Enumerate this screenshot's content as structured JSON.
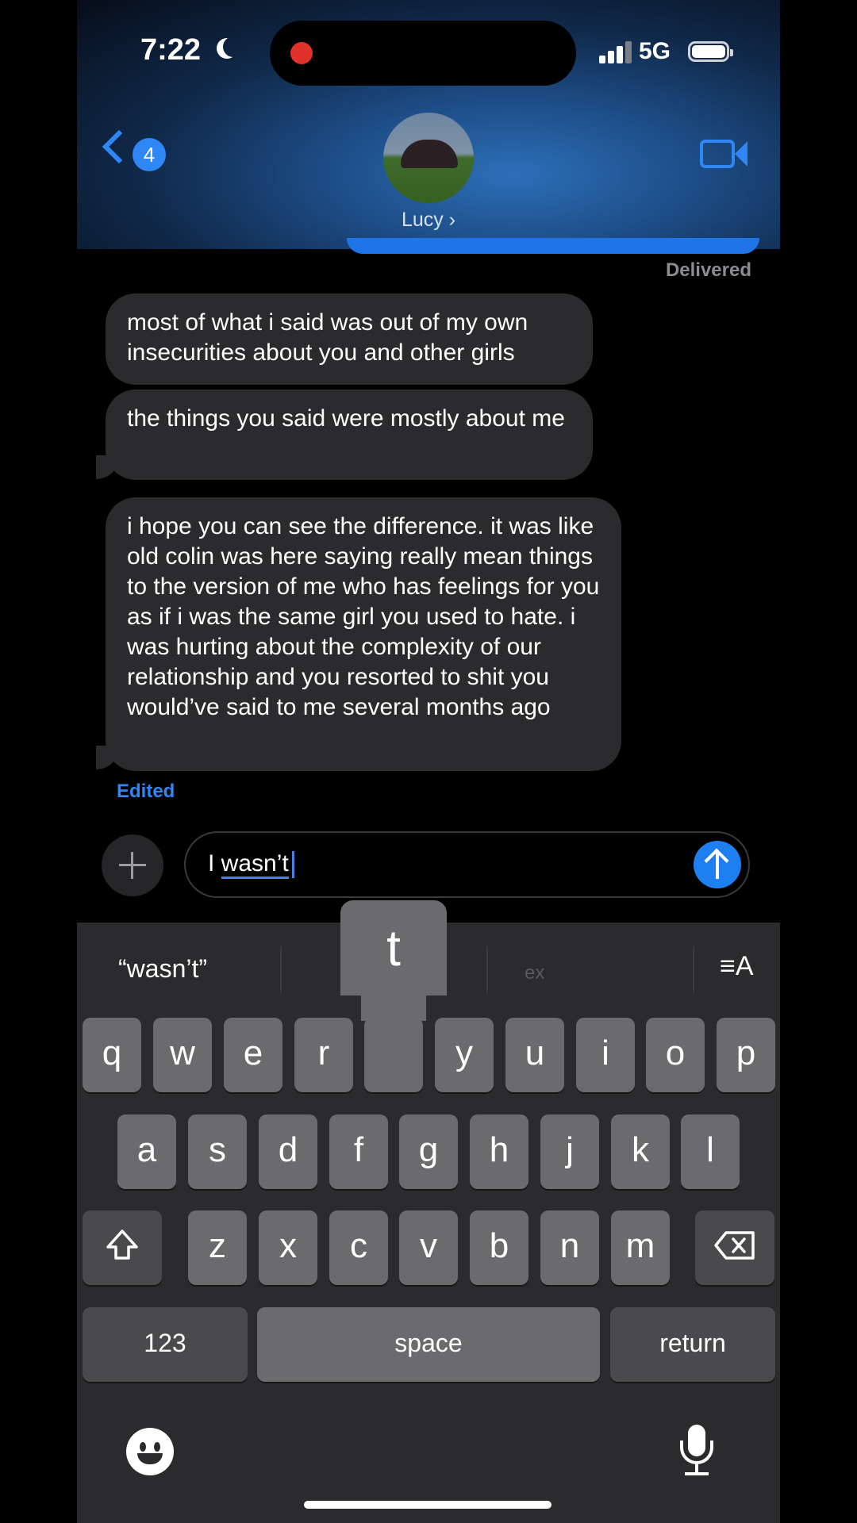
{
  "status_bar": {
    "time": "7:22",
    "network": "5G",
    "icons": [
      "moon-icon",
      "recording-dot",
      "signal-icon",
      "battery-icon"
    ]
  },
  "header": {
    "back_badge": "4",
    "contact_name": "Lucy ›",
    "video_icon": "video-camera-icon"
  },
  "conversation": {
    "delivered_label": "Delivered",
    "messages": [
      {
        "text": "most of what i said was out of my own insecurities about you and other girls"
      },
      {
        "text": "the things you said were mostly about me"
      },
      {
        "text": "i hope you can see the difference. it was like old colin was here saying really mean things to the version of me who has feelings for you as if i was the same girl you used to hate. i was hurting about the complexity of our relationship and you resorted to shit you would’ve said to me several months ago"
      }
    ],
    "edited_label": "Edited"
  },
  "composer": {
    "prefix": "I ",
    "underlined_word": "wasn’t"
  },
  "keyboard": {
    "suggestions": [
      "“wasn’t”",
      "",
      "ex"
    ],
    "popup_key": "t",
    "row1": [
      "q",
      "w",
      "e",
      "r",
      "t",
      "y",
      "u",
      "i",
      "o",
      "p"
    ],
    "row2": [
      "a",
      "s",
      "d",
      "f",
      "g",
      "h",
      "j",
      "k",
      "l"
    ],
    "row3": [
      "z",
      "x",
      "c",
      "v",
      "b",
      "n",
      "m"
    ],
    "numbers_label": "123",
    "space_label": "space",
    "return_label": "return",
    "format_label": "≡A"
  },
  "colors": {
    "accent": "#2f86f5",
    "bubble": "#2b2b2e",
    "key": "#6b6b6e",
    "keyboard_bg": "#2b2b2d"
  }
}
